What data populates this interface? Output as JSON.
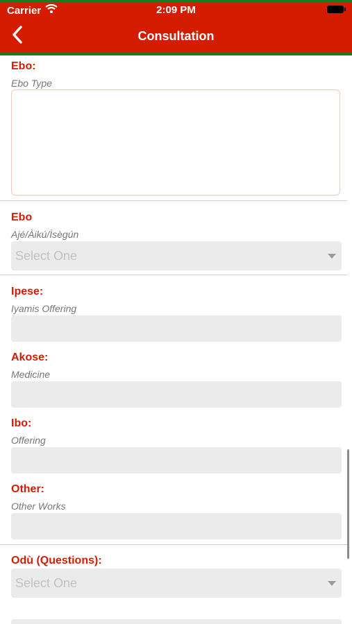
{
  "status": {
    "carrier": "Carrier",
    "time": "2:09 PM"
  },
  "nav": {
    "title": "Consultation"
  },
  "form": {
    "ebo_type": {
      "label": "Ebo:",
      "sub": "Ebo Type",
      "value": ""
    },
    "ebo_select": {
      "label": "Ebo",
      "sub": "Ajé/Àikú/Ìsègún",
      "value": "Select One"
    },
    "ipese": {
      "label": "Ipese:",
      "sub": "Iyamis Offering",
      "value": ""
    },
    "akose": {
      "label": "Akose:",
      "sub": "Medicine",
      "value": ""
    },
    "ibo": {
      "label": "Ibo:",
      "sub": "Offering",
      "value": ""
    },
    "other": {
      "label": "Other:",
      "sub": "Other Works",
      "value": ""
    },
    "odu": {
      "label": "Odù (Questions):",
      "value": "Select One"
    }
  },
  "colors": {
    "header": "#d41c00",
    "accent_stripe": "#1f7a1f",
    "label": "#d41c00"
  },
  "icons": {
    "back": "chevron-left-icon",
    "wifi": "wifi-icon",
    "battery": "battery-icon",
    "dropdown": "caret-down-icon"
  }
}
